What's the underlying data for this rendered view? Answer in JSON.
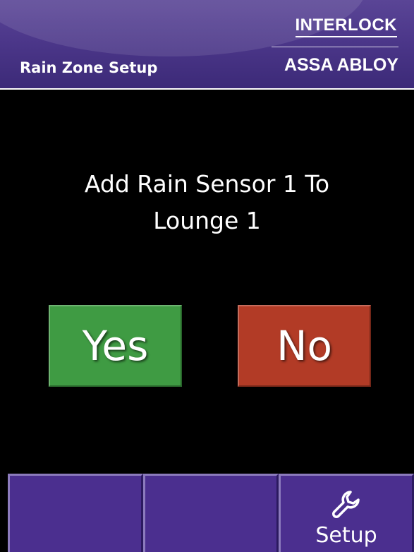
{
  "header": {
    "title": "Rain Zone Setup",
    "brand_top": "INTERLOCK",
    "brand_bottom": "ASSA ABLOY"
  },
  "dialog": {
    "message_line1": "Add Rain Sensor 1 To",
    "message_line2": "Lounge 1",
    "yes_label": "Yes",
    "no_label": "No"
  },
  "nav": {
    "buttons": [
      {
        "label": "",
        "icon": ""
      },
      {
        "label": "",
        "icon": ""
      },
      {
        "label": "Setup",
        "icon": "wrench-icon"
      }
    ]
  },
  "colors": {
    "header": "#4c378a",
    "yes": "#3f9b43",
    "no": "#b23b26",
    "nav": "#4b2f8f",
    "background": "#000000"
  }
}
